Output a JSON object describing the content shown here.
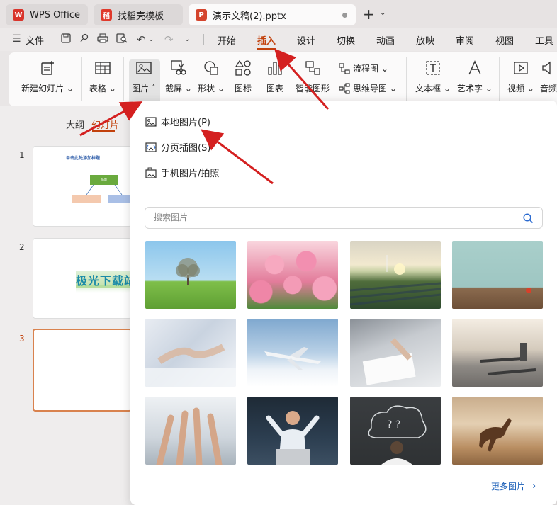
{
  "tabs": [
    {
      "label": "WPS Office",
      "logo": "W",
      "color": "#d9342b"
    },
    {
      "label": "找稻壳模板",
      "logo": "稻",
      "color": "#e0392b"
    },
    {
      "label": "演示文稿(2).pptx",
      "logo": "P",
      "color": "#d4442d"
    }
  ],
  "menubar": {
    "file": "文件",
    "tabs": [
      "开始",
      "插入",
      "设计",
      "切换",
      "动画",
      "放映",
      "审阅",
      "视图",
      "工具"
    ],
    "active": "插入"
  },
  "ribbon": {
    "new_slide": "新建幻灯片",
    "table": "表格",
    "picture": "图片",
    "screenshot": "截屏",
    "shape": "形状",
    "icon": "图标",
    "chart": "图表",
    "smartart": "智能图形",
    "flowchart": "流程图",
    "mindmap": "思维导图",
    "textbox": "文本框",
    "wordart": "艺术字",
    "video": "视频",
    "audio": "音频"
  },
  "left_panel": {
    "view_tabs": [
      "大纲",
      "幻灯片"
    ],
    "active_view": "幻灯片",
    "slides": [
      {
        "number": "1",
        "title": "单击此处添加标题",
        "node": "标题"
      },
      {
        "number": "2",
        "wordart": "极光下载站"
      },
      {
        "number": "3"
      }
    ]
  },
  "picture_menu": {
    "items": [
      "本地图片(P)",
      "分页插图(S)",
      "手机图片/拍照"
    ],
    "search_placeholder": "搜索图片",
    "more_label": "更多图片",
    "photos": [
      "tree-on-meadow",
      "pink-tulips",
      "solar-field-sunrise",
      "teal-wall-table",
      "business-handshake",
      "airplane-clouds",
      "hands-pointing-documents",
      "gym-treadmills",
      "team-hands-raised",
      "excited-man-laptop",
      "thinking-man-chalkboard",
      "running-horse"
    ]
  },
  "colors": {
    "accent": "#c2410c",
    "link": "#1b5fb8",
    "arrow": "#d42020"
  }
}
